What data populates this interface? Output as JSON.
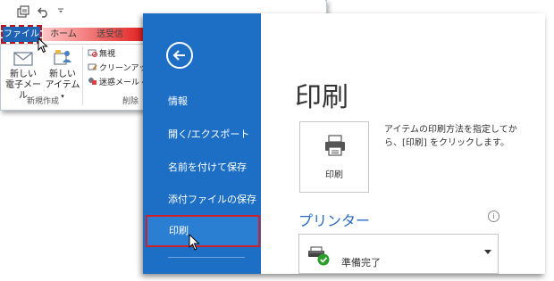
{
  "ribbon": {
    "tabs": {
      "file": "ファイル",
      "home": "ホーム",
      "send_receive": "送受信"
    },
    "new_group": {
      "new_mail_line1": "新しい",
      "new_mail_line2": "電子メール",
      "new_items_line1": "新しい",
      "new_items_line2": "アイテム",
      "label": "新規作成"
    },
    "delete_group": {
      "ignore": "無視",
      "cleanup": "クリーンアップ",
      "junk": "迷惑メール",
      "label": "削除"
    }
  },
  "backstage": {
    "nav": {
      "info": "情報",
      "open_export": "開く/エクスポート",
      "save_as": "名前を付けて保存",
      "save_attachments": "添付ファイルの保存",
      "print": "印刷"
    },
    "title": "印刷",
    "print_button": "印刷",
    "description": "アイテムの印刷方法を指定してから、[印刷] をクリックします。",
    "printer_heading": "プリンター",
    "printer_status": "準備完了",
    "info_glyph": "i"
  },
  "colors": {
    "backstage_blue": "#1d6fc6",
    "selected_nav": "#2b7fd3",
    "highlight_red": "#d0202a",
    "file_tab": "#1f63b5",
    "printer_heading": "#2a6bbf"
  }
}
